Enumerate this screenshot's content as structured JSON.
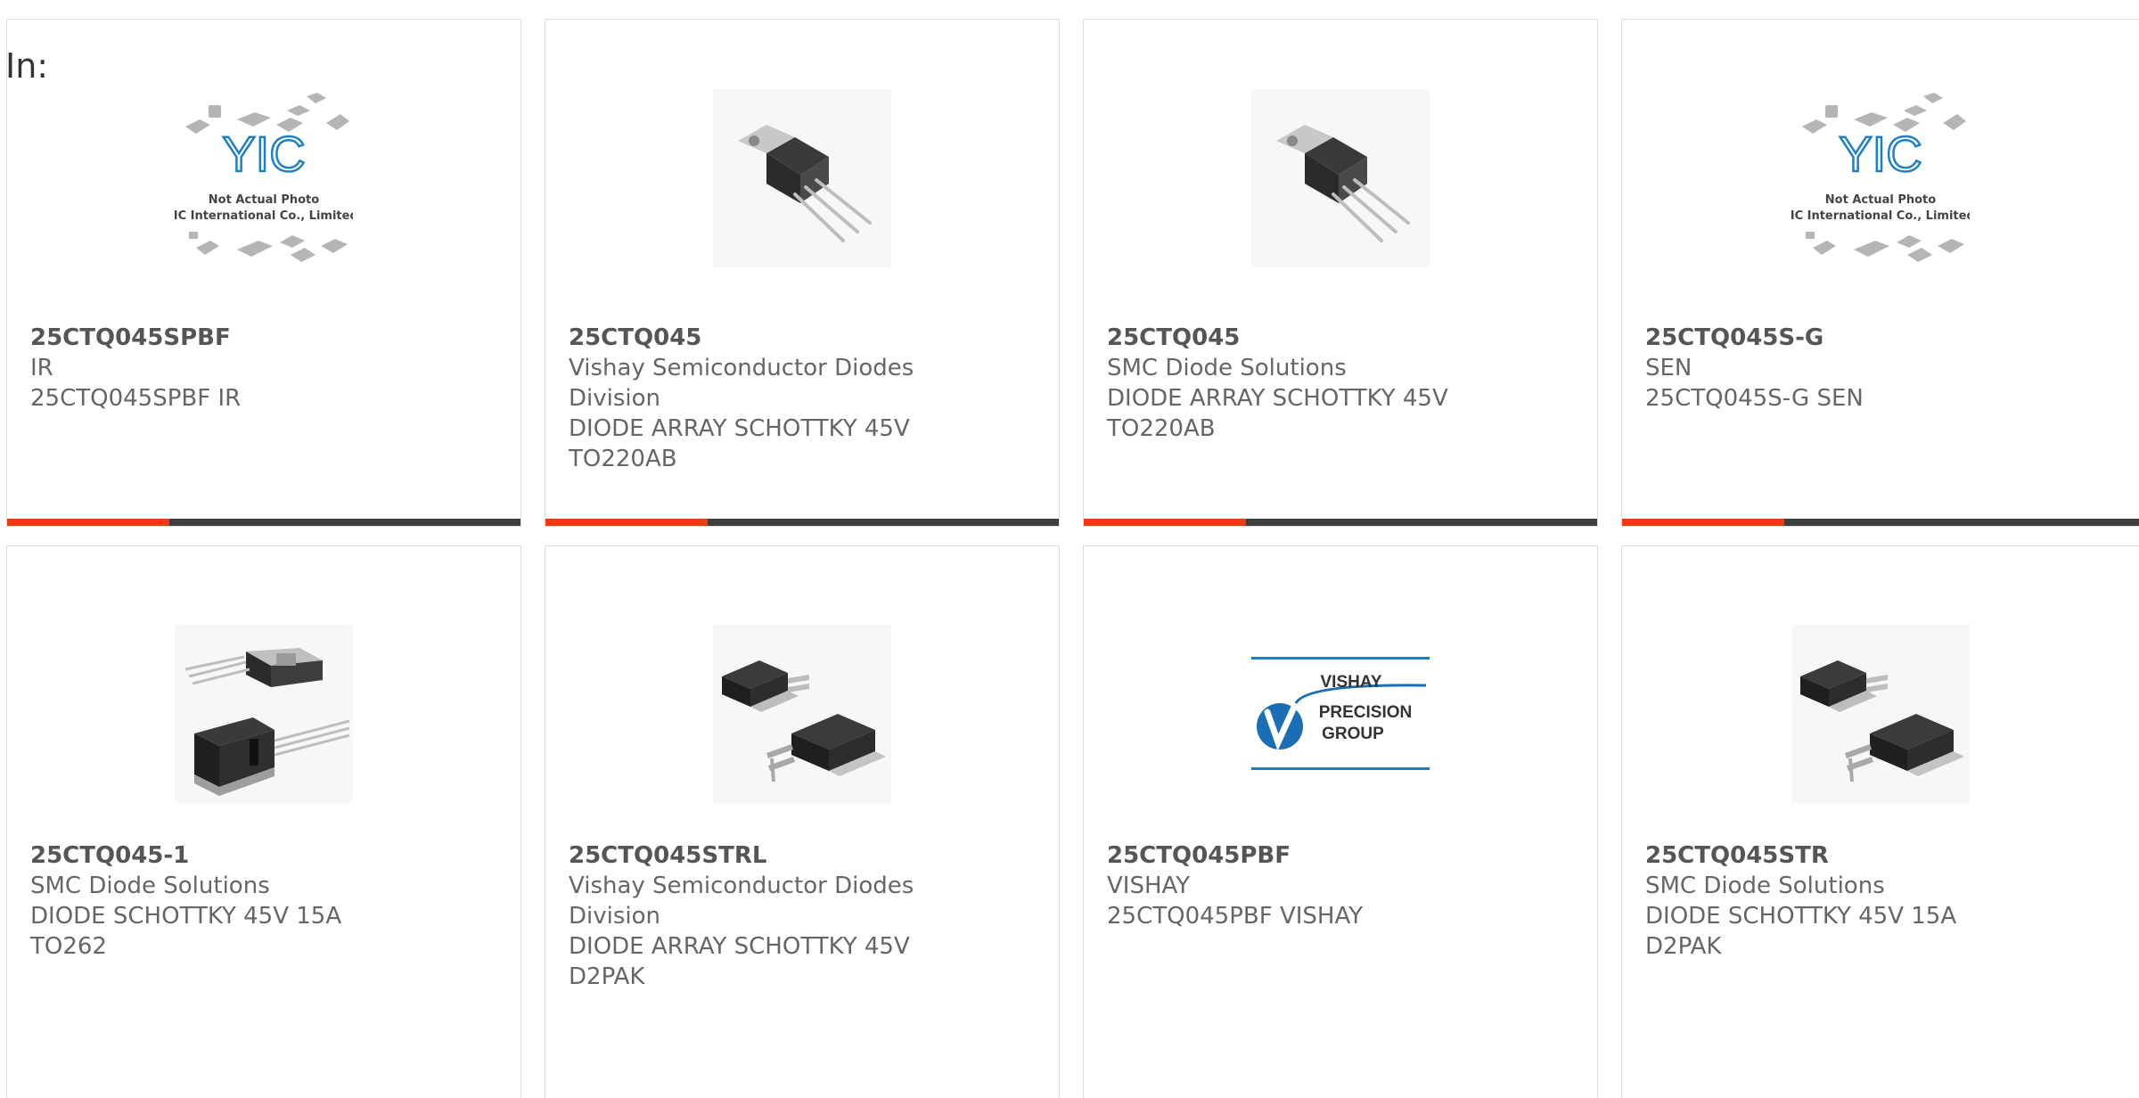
{
  "header": {
    "prefix": "In:"
  },
  "placeholder_image": {
    "line1": "Not Actual Photo",
    "line2": "YIC International Co., Limited.",
    "logo_text": "YIC"
  },
  "vishay_logo": {
    "line1": "VISHAY",
    "line2": "PRECISION",
    "line3": "GROUP"
  },
  "colors": {
    "accent": "#ee3a10",
    "bar": "#3f3f3f",
    "border": "#dcdcdc"
  },
  "products": [
    {
      "part": "25CTQ045SPBF",
      "lines": [
        "IR",
        "25CTQ045SPBF IR",
        ""
      ],
      "image": "placeholder-image"
    },
    {
      "part": "25CTQ045",
      "lines": [
        "Vishay Semiconductor Diodes",
        "Division",
        "DIODE ARRAY SCHOTTKY 45V",
        "TO220AB"
      ],
      "image": "to220-image"
    },
    {
      "part": "25CTQ045",
      "lines": [
        "SMC Diode Solutions",
        "DIODE ARRAY SCHOTTKY 45V",
        "TO220AB",
        ""
      ],
      "image": "to220-image"
    },
    {
      "part": "25CTQ045S-G",
      "lines": [
        "SEN",
        "25CTQ045S-G SEN",
        ""
      ],
      "image": "placeholder-image"
    },
    {
      "part": "25CTQ045-1",
      "lines": [
        "SMC Diode Solutions",
        "DIODE SCHOTTKY 45V 15A",
        "TO262",
        ""
      ],
      "image": "to262-image"
    },
    {
      "part": "25CTQ045STRL",
      "lines": [
        "Vishay Semiconductor Diodes",
        "Division",
        "DIODE ARRAY SCHOTTKY 45V",
        "D2PAK"
      ],
      "image": "d2pak-image"
    },
    {
      "part": "25CTQ045PBF",
      "lines": [
        "VISHAY",
        "25CTQ045PBF VISHAY",
        ""
      ],
      "image": "vishay-logo-image"
    },
    {
      "part": "25CTQ045STR",
      "lines": [
        "SMC Diode Solutions",
        "DIODE SCHOTTKY 45V 15A",
        "D2PAK",
        ""
      ],
      "image": "d2pak-image"
    }
  ]
}
